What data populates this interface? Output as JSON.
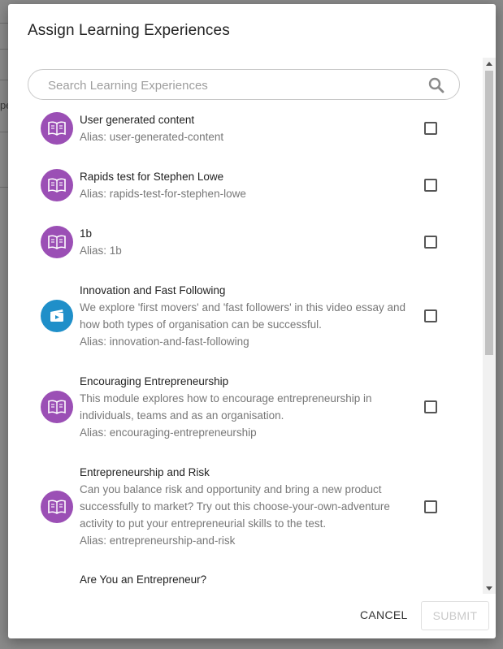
{
  "background": {
    "stub_text": "pe"
  },
  "dialog": {
    "title": "Assign Learning Experiences",
    "search": {
      "placeholder": "Search Learning Experiences",
      "value": ""
    },
    "items": [
      {
        "type": "module",
        "title": "User generated content",
        "description": "",
        "alias": "Alias: user-generated-content"
      },
      {
        "type": "module",
        "title": "Rapids test for Stephen Lowe",
        "description": "",
        "alias": "Alias: rapids-test-for-stephen-lowe"
      },
      {
        "type": "module",
        "title": "1b",
        "description": "",
        "alias": "Alias: 1b"
      },
      {
        "type": "video",
        "title": "Innovation and Fast Following",
        "description": "We explore 'first movers' and 'fast followers' in this video essay and how both types of organisation can be successful.",
        "alias": "Alias: innovation-and-fast-following"
      },
      {
        "type": "module",
        "title": "Encouraging Entrepreneurship",
        "description": "This module explores how to encourage entrepreneurship in individuals, teams and as an organisation.",
        "alias": "Alias: encouraging-entrepreneurship"
      },
      {
        "type": "module",
        "title": "Entrepreneurship and Risk",
        "description": "Can you balance risk and opportunity and bring a new product successfully to market? Try out this choose-your-own-adventure activity to put your entrepreneurial skills to the test.",
        "alias": "Alias: entrepreneurship-and-risk"
      },
      {
        "type": "module",
        "title": "Are You an Entrepreneur?",
        "description": "",
        "alias": ""
      }
    ],
    "footer": {
      "cancel_label": "CANCEL",
      "submit_label": "SUBMIT"
    }
  },
  "colors": {
    "module_icon": "#9b4fb5",
    "video_icon": "#1f8fc9"
  }
}
